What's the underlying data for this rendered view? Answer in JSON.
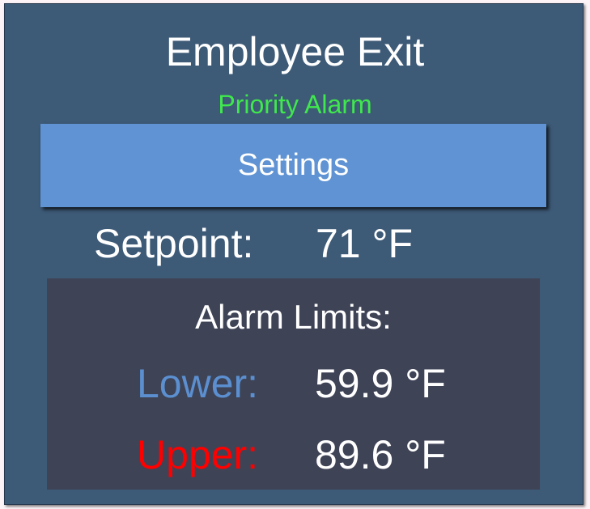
{
  "title": "Employee Exit",
  "subtitle": "Priority Alarm",
  "settings_label": "Settings",
  "setpoint": {
    "label": "Setpoint:",
    "value": "71 °F"
  },
  "alarm_limits": {
    "heading": "Alarm Limits:",
    "lower": {
      "label": "Lower:",
      "value": "59.9 °F",
      "color": "#5b8fd0"
    },
    "upper": {
      "label": "Upper:",
      "value": "89.6 °F",
      "color": "#ff0000"
    }
  }
}
